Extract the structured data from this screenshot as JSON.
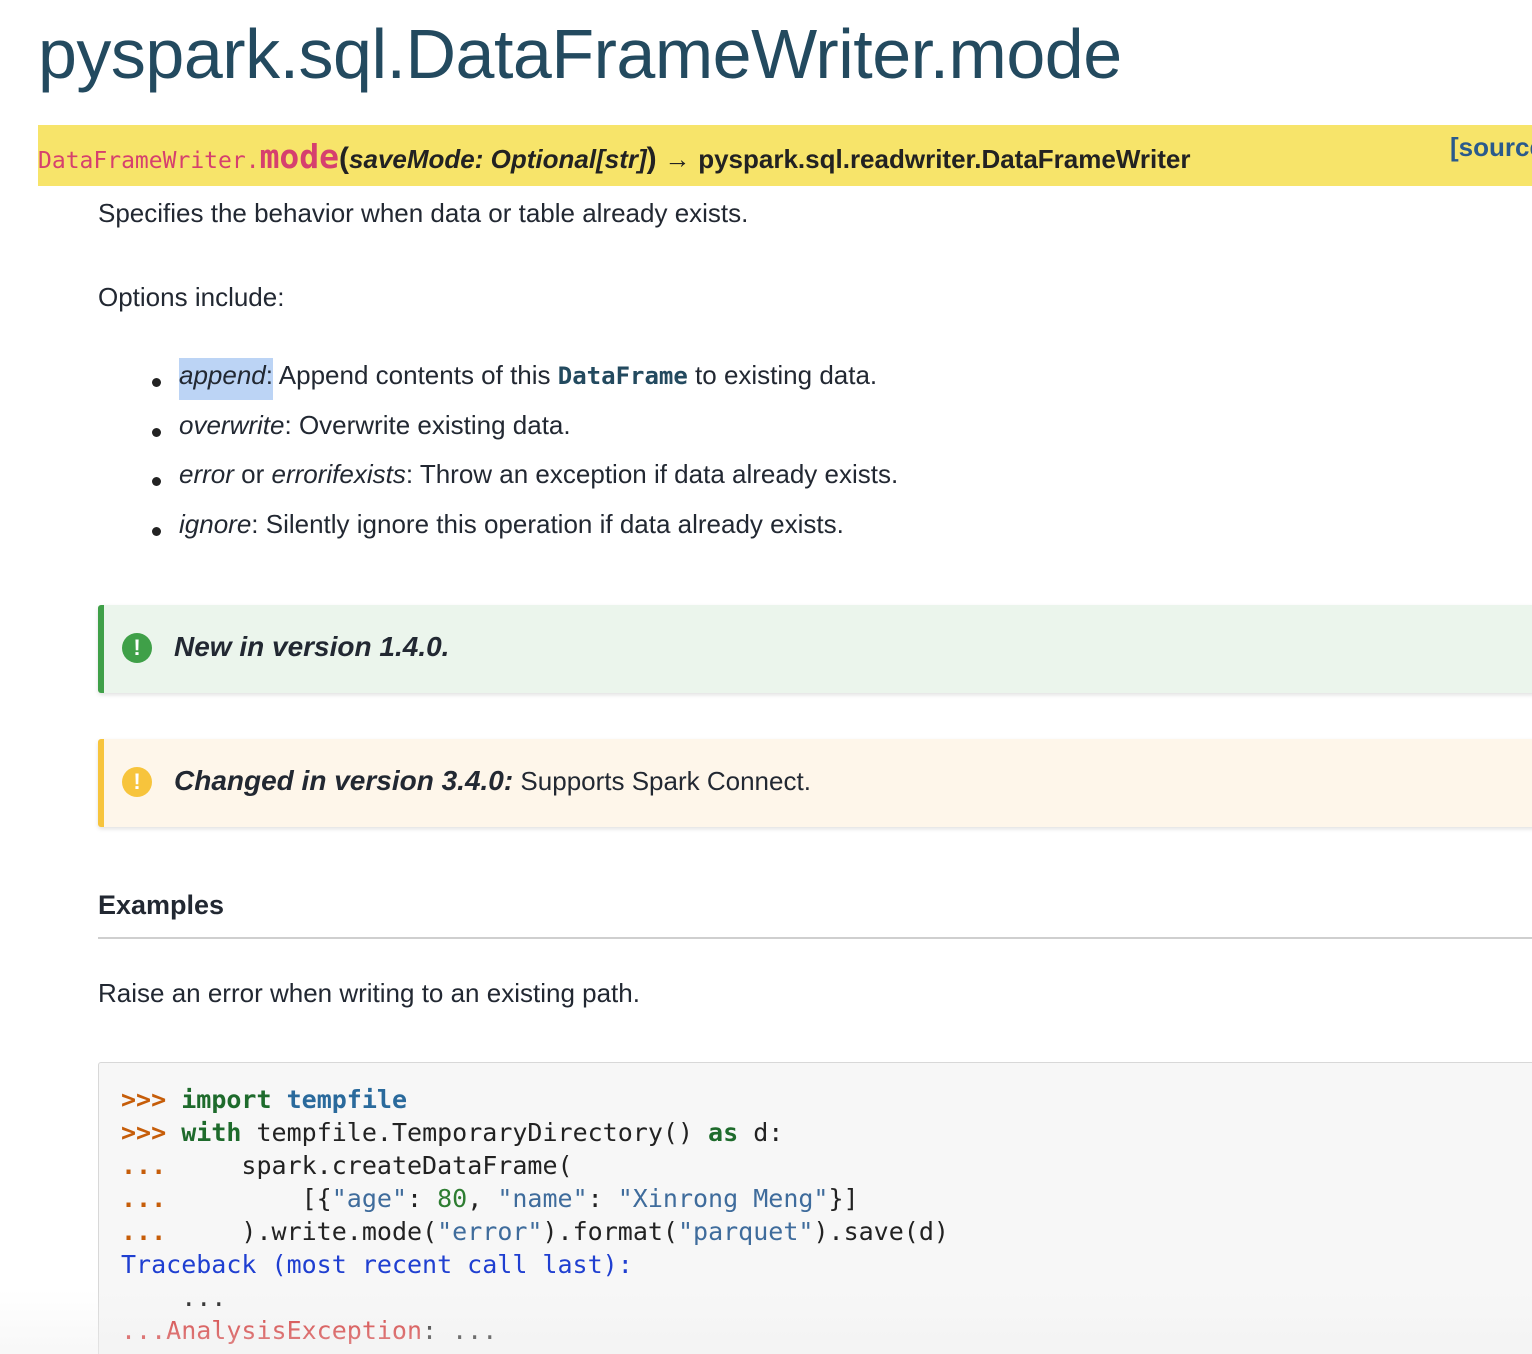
{
  "page": {
    "title": "pyspark.sql.DataFrameWriter.mode"
  },
  "signature": {
    "class_prefix": "DataFrameWriter.",
    "function_name": "mode",
    "open_paren": "(",
    "param": "saveMode: Optional[str]",
    "close_paren": ")",
    "arrow": "→",
    "return_type": "pyspark.sql.readwriter.DataFrameWriter",
    "source_link": "[source]"
  },
  "description": "Specifies the behavior when data or table already exists.",
  "options_intro": "Options include:",
  "options": [
    {
      "name": "append",
      "sep": ":",
      "pre": " Append contents of this ",
      "ref": "DataFrame",
      "post": " to existing data."
    },
    {
      "name": "overwrite",
      "sep": ":",
      "text": " Overwrite existing data."
    },
    {
      "name": "error",
      "mid": " or ",
      "name2": "errorifexists",
      "sep": ":",
      "text": " Throw an exception if data already exists."
    },
    {
      "name": "ignore",
      "sep": ":",
      "text": " Silently ignore this operation if data already exists."
    }
  ],
  "admonitions": {
    "new": {
      "icon": "exclamation-circle-icon",
      "label": "New in version 1.4.0."
    },
    "changed": {
      "icon": "exclamation-circle-icon",
      "label": "Changed in version 3.4.0:",
      "text": " Supports Spark Connect."
    }
  },
  "examples": {
    "heading": "Examples",
    "intro": "Raise an error when writing to an existing path."
  },
  "code": {
    "prompt": ">>>",
    "cont": "...",
    "line1": {
      "kw": "import",
      "mod": "tempfile"
    },
    "line2": {
      "kw": "with",
      "a": " tempfile",
      "dot": ".",
      "b": "TemporaryDirectory() ",
      "as": "as",
      "c": " d:"
    },
    "line3": {
      "a": "     spark",
      "dot": ".",
      "b": "createDataFrame("
    },
    "line4": {
      "a": "         [{",
      "s1": "\"age\"",
      "b": ": ",
      "n": "80",
      "c": ", ",
      "s2": "\"name\"",
      "d": ": ",
      "s3": "\"Xinrong Meng\"",
      "e": "}]"
    },
    "line5": {
      "a": "     )",
      "dot1": ".",
      "b": "write",
      "dot2": ".",
      "c": "mode(",
      "s1": "\"error\"",
      "d": ")",
      "dot3": ".",
      "e": "format(",
      "s2": "\"parquet\"",
      "f": ")",
      "dot4": ".",
      "g": "save(d)"
    },
    "traceback": "Traceback (most recent call last):",
    "ellipsis": "    ...",
    "error_prefix": "...AnalysisException",
    "error_suffix": ": ..."
  },
  "colors": {
    "title": "#234a5f",
    "signature_bg": "#f7e46a",
    "function_pink": "#d6406e",
    "new_green": "#3fa048",
    "changed_yellow": "#f7c43c",
    "selection": "#bcd4f5"
  }
}
